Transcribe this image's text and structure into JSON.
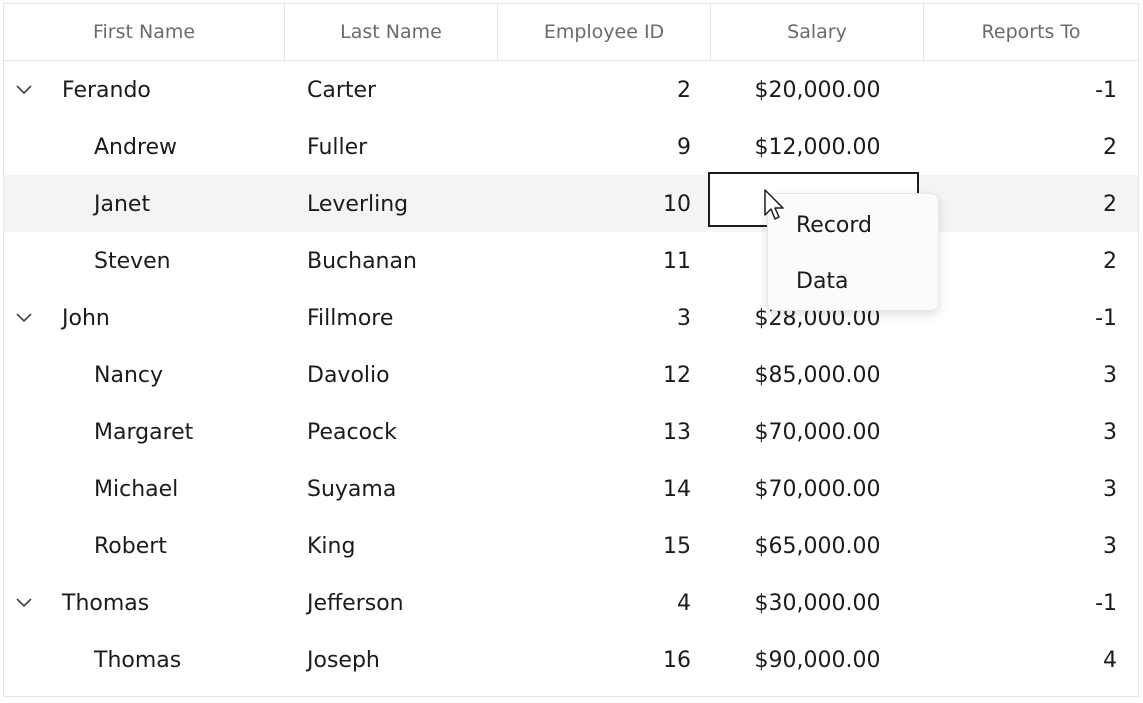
{
  "columns": [
    "First Name",
    "Last Name",
    "Employee ID",
    "Salary",
    "Reports To"
  ],
  "rows": [
    {
      "first": "Ferando",
      "last": "Carter",
      "id": "2",
      "salary": "$20,000.00",
      "reports": "-1",
      "parent": true
    },
    {
      "first": "Andrew",
      "last": "Fuller",
      "id": "9",
      "salary": "$12,000.00",
      "reports": "2"
    },
    {
      "first": "Janet",
      "last": "Leverling",
      "id": "10",
      "salary": "",
      "reports": "2",
      "selected": true
    },
    {
      "first": "Steven",
      "last": "Buchanan",
      "id": "11",
      "salary": "",
      "reports": "2"
    },
    {
      "first": "John",
      "last": "Fillmore",
      "id": "3",
      "salary": "$28,000.00",
      "reports": "-1",
      "parent": true
    },
    {
      "first": "Nancy",
      "last": "Davolio",
      "id": "12",
      "salary": "$85,000.00",
      "reports": "3"
    },
    {
      "first": "Margaret",
      "last": "Peacock",
      "id": "13",
      "salary": "$70,000.00",
      "reports": "3"
    },
    {
      "first": "Michael",
      "last": "Suyama",
      "id": "14",
      "salary": "$70,000.00",
      "reports": "3"
    },
    {
      "first": "Robert",
      "last": "King",
      "id": "15",
      "salary": "$65,000.00",
      "reports": "3"
    },
    {
      "first": "Thomas",
      "last": "Jefferson",
      "id": "4",
      "salary": "$30,000.00",
      "reports": "-1",
      "parent": true
    },
    {
      "first": "Thomas",
      "last": "Joseph",
      "id": "16",
      "salary": "$90,000.00",
      "reports": "4"
    }
  ],
  "context_menu": {
    "items": [
      "Record",
      "Data"
    ]
  },
  "icons": {
    "expand": "chevron-down-icon",
    "cursor": "mouse-pointer-icon"
  }
}
